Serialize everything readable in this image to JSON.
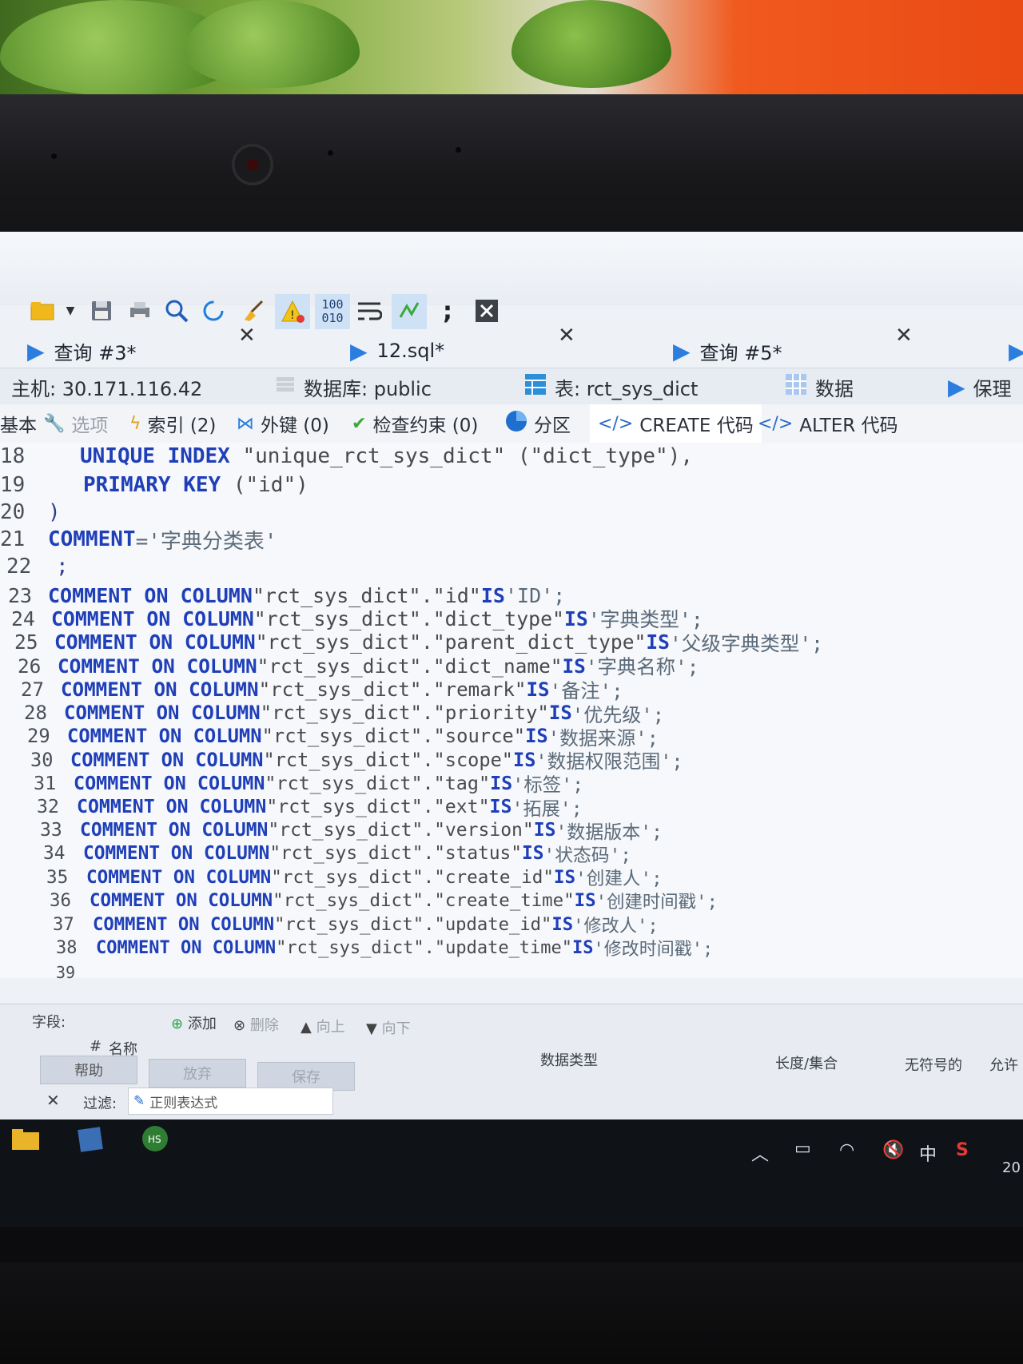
{
  "toolbar": {
    "icons": [
      "folder-icon",
      "save-icon",
      "print-icon",
      "search-icon",
      "refresh-icon",
      "broom-icon",
      "warning-icon",
      "binary-icon",
      "wrap-icon",
      "format-icon",
      "comment-icon",
      "close-icon"
    ],
    "binary_top": "100",
    "binary_bottom": "010"
  },
  "tabs": [
    {
      "label": "查询 #3*"
    },
    {
      "label": "12.sql*"
    },
    {
      "label": "查询 #5*"
    }
  ],
  "info": {
    "host": "主机: 30.171.116.42",
    "database": "数据库: public",
    "table": "表: rct_sys_dict",
    "data": "数据",
    "save": "保理"
  },
  "prop_tabs": [
    "基本",
    "选项",
    "索引 (2)",
    "外键 (0)",
    "检查约束 (0)",
    "分区",
    "CREATE 代码",
    "ALTER 代码"
  ],
  "code": {
    "l18_num": "18",
    "l18_a": "UNIQUE INDEX",
    "l18_b": " \"unique_rct_sys_dict\" (\"dict_type\"),",
    "l19_num": "19",
    "l19_a": "PRIMARY KEY",
    "l19_b": " (\"id\")",
    "l20_num": "20",
    "l20_b": ")",
    "l21_num": "21",
    "l21_a": "COMMENT",
    "l21_b": "='字典分类表'",
    "l22_num": "22",
    "l22_b": ";",
    "comment_kw": "COMMENT ON COLUMN",
    "is_kw": "IS",
    "rows": [
      {
        "num": "23",
        "col": "\"rct_sys_dict\".\"id\"",
        "val": "'ID';"
      },
      {
        "num": "24",
        "col": "\"rct_sys_dict\".\"dict_type\"",
        "val": "'字典类型';"
      },
      {
        "num": "25",
        "col": "\"rct_sys_dict\".\"parent_dict_type\"",
        "val": "'父级字典类型';"
      },
      {
        "num": "26",
        "col": "\"rct_sys_dict\".\"dict_name\"",
        "val": "'字典名称';"
      },
      {
        "num": "27",
        "col": "\"rct_sys_dict\".\"remark\"",
        "val": "'备注';"
      },
      {
        "num": "28",
        "col": "\"rct_sys_dict\".\"priority\"",
        "val": "'优先级';"
      },
      {
        "num": "29",
        "col": "\"rct_sys_dict\".\"source\"",
        "val": "'数据来源';"
      },
      {
        "num": "30",
        "col": "\"rct_sys_dict\".\"scope\"",
        "val": "'数据权限范围';"
      },
      {
        "num": "31",
        "col": "\"rct_sys_dict\".\"tag\"",
        "val": "'标签';"
      },
      {
        "num": "32",
        "col": "\"rct_sys_dict\".\"ext\"",
        "val": "'拓展';"
      },
      {
        "num": "33",
        "col": "\"rct_sys_dict\".\"version\"",
        "val": "'数据版本';"
      },
      {
        "num": "34",
        "col": "\"rct_sys_dict\".\"status\"",
        "val": "'状态码';"
      },
      {
        "num": "35",
        "col": "\"rct_sys_dict\".\"create_id\"",
        "val": "'创建人';"
      },
      {
        "num": "36",
        "col": "\"rct_sys_dict\".\"create_time\"",
        "val": "'创建时间戳';"
      },
      {
        "num": "37",
        "col": "\"rct_sys_dict\".\"update_id\"",
        "val": "'修改人';"
      },
      {
        "num": "38",
        "col": "\"rct_sys_dict\".\"update_time\"",
        "val": "'修改时间戳';"
      }
    ],
    "l39_num": "39"
  },
  "fields_panel": {
    "label": "字段:",
    "add": "添加",
    "delete": "删除",
    "up": "向上",
    "down": "向下",
    "col_hash": "#",
    "col_name": "名称",
    "col_type": "数据类型",
    "col_length": "长度/集合",
    "col_unsigned": "无符号的",
    "col_allow": "允许",
    "help": "帮助",
    "discard": "放弃",
    "save": "保存",
    "filter_label": "过滤:",
    "filter_placeholder": "正则表达式"
  },
  "taskbar": {
    "ime": "中",
    "clock": "20"
  },
  "colors": {
    "keyword": "#1f3fb8",
    "tab_play": "#2b7de0",
    "screen_bg": "#eef1f6"
  }
}
